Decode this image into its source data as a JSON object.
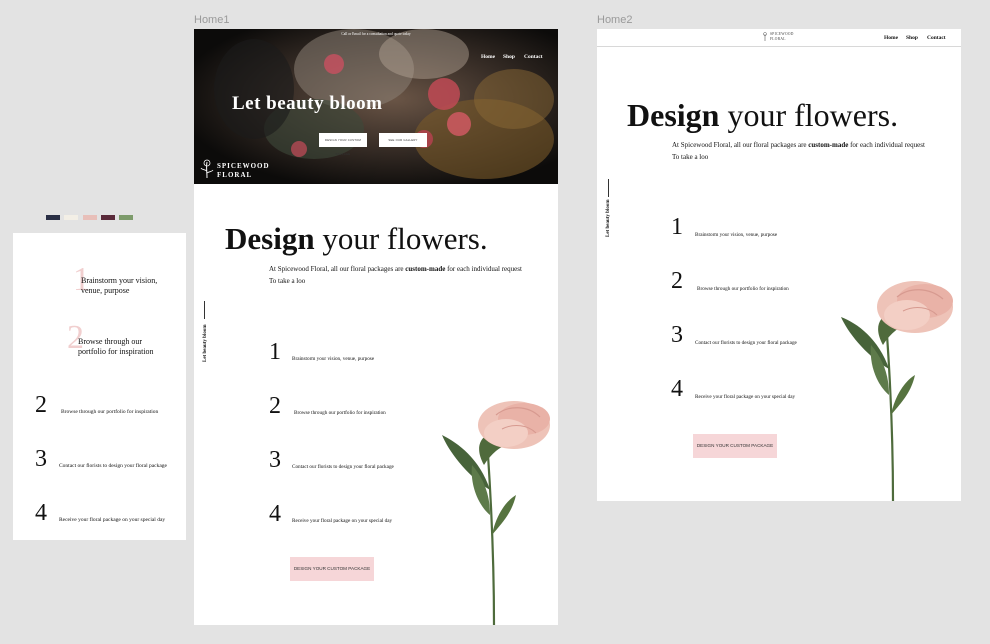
{
  "canvas": {
    "frames": [
      {
        "label": "Home1"
      },
      {
        "label": "Home2"
      }
    ]
  },
  "palette": [
    "#2a2f45",
    "#f3efe6",
    "#e8bfb9",
    "#5a2a3a",
    "#7d9b6b"
  ],
  "mobile": {
    "steps": [
      {
        "num": "1",
        "text": "Brainstorm your vision, venue, purpose"
      },
      {
        "num": "2",
        "text": "Browse through our portfolio for inspiration"
      }
    ],
    "plain_steps": [
      {
        "num": "2",
        "text": "Browse through our portfolio for inspiration"
      },
      {
        "num": "3",
        "text": "Contact our florists to design your floral package"
      },
      {
        "num": "4",
        "text": "Receive your floral package on your special day"
      }
    ]
  },
  "home1": {
    "announcement": "Call or Email for a consultation and quote today",
    "nav": [
      "Home",
      "Shop",
      "Contact"
    ],
    "hero_title": "Let beauty bloom",
    "hero_buttons": [
      "DESIGN YOUR CUSTOM PACKAGE",
      "SEE OUR GALLERY"
    ],
    "logo_line1": "SPICEWOOD",
    "logo_line2": "FLORAL",
    "headline_bold": "Design",
    "headline_rest": "your flowers.",
    "subtext_pre": "At Spicewood Floral, all our floral packages are",
    "subtext_bold": "custom-made",
    "subtext_post": "for each individual request",
    "subtext_line2": "To take a loo",
    "side_label": "Let beauty bloom",
    "steps": [
      {
        "num": "1",
        "text": "Brainstorm your vision, venue, purpose"
      },
      {
        "num": "2",
        "text": "Browse through our portfolio for inspiration"
      },
      {
        "num": "3",
        "text": "Contact our florists to design your floral package"
      },
      {
        "num": "4",
        "text": "Receive your floral package on your special day"
      }
    ],
    "cta": "DESIGN YOUR CUSTOM PACKAGE"
  },
  "home2": {
    "logo_line1": "SPICEWOOD",
    "logo_line2": "FLORAL",
    "nav": [
      "Home",
      "Shop",
      "Contact"
    ],
    "headline_bold": "Design",
    "headline_rest": "your flowers.",
    "subtext_pre": "At Spicewood Floral, all our floral packages are",
    "subtext_bold": "custom-made",
    "subtext_post": "for each individual request",
    "subtext_line2": "To take a loo",
    "side_label": "Let beauty bloom",
    "steps": [
      {
        "num": "1",
        "text": "Brainstorm your vision, venue, purpose"
      },
      {
        "num": "2",
        "text": "Browse through our portfolio for inspiration"
      },
      {
        "num": "3",
        "text": "Contact our florists to design your floral package"
      },
      {
        "num": "4",
        "text": "Receive your floral package on your special day"
      }
    ],
    "cta": "DESIGN YOUR CUSTOM PACKAGE"
  }
}
